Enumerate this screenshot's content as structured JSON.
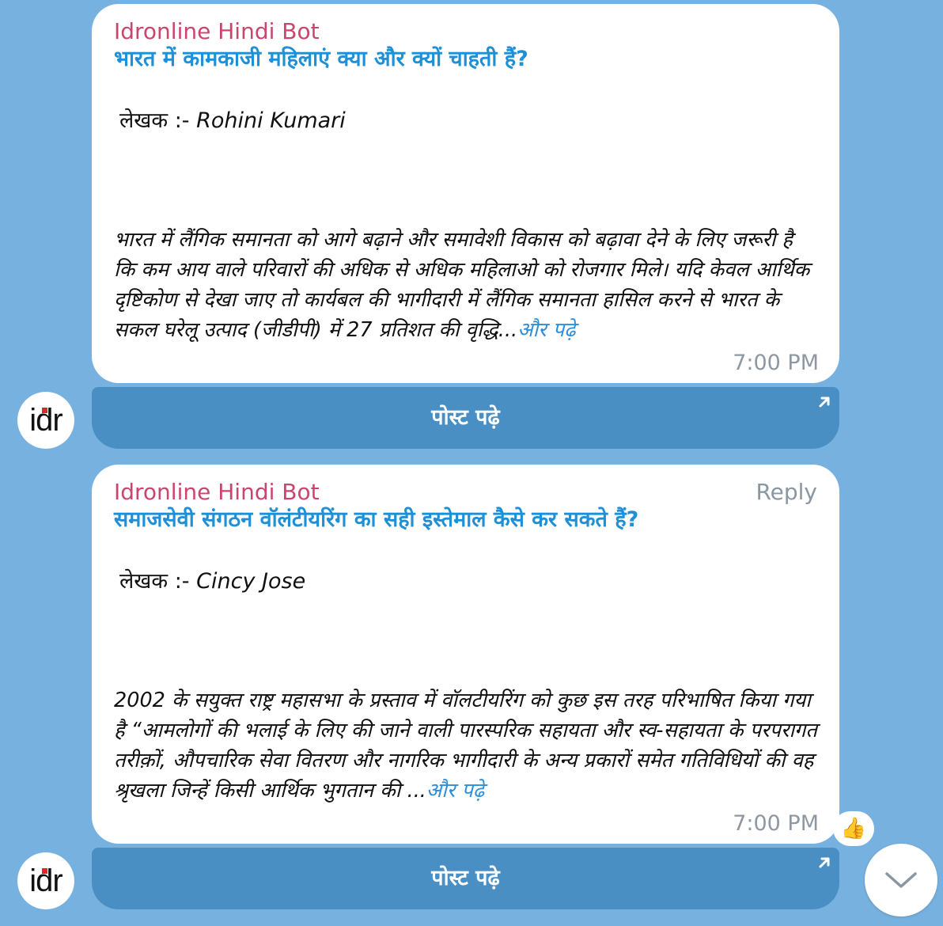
{
  "messages": [
    {
      "sender": "Idronline Hindi Bot",
      "title": "भारत में कामकाजी महिलाएं क्या और क्यों चाहती हैं?",
      "author_label": "लेखक :-",
      "author_name": "Rohini Kumari",
      "excerpt": "भारत में लैंगिक समानता को आगे बढ़ाने और समावेशी विकास को बढ़ावा देने के लिए जरूरी है कि कम आय वाले परिवारों की अधिक से अधिक महिलाओ को रोजगार मिले। यदि केवल आर्थिक दृष्टिकोण से देखा जाए तो कार्यबल की भागीदारी में लैंगिक समानता हासिल करने से भारत के सकल घरेलू उत्पाद (जीडीपी) में 27 प्रतिशत की वृद्धि...",
      "read_more": "और पढ़े",
      "time": "7:00 PM",
      "button_label": "पोस्ट पढ़े"
    },
    {
      "sender": "Idronline Hindi Bot",
      "reply_label": "Reply",
      "title": "समाजसेवी संगठन वॉलंटीयरिंग का सही इस्तेमाल कैसे कर सकते हैं?",
      "author_label": "लेखक :-",
      "author_name": "Cincy Jose",
      "excerpt": "2002 के सयुक्त राष्ट्र महासभा के प्रस्ताव में वॉलटीयरिंग को कुछ इस तरह परिभाषित किया गया है “आमलोगों की भलाई के लिए की जाने वाली पारस्परिक सहायता और स्व-सहायता के परपरागत तरीक़ों, औपचारिक सेवा वितरण और नागरिक भागीदारी के अन्य प्रकारों समेत गतिविधियों की वह श्रृखला जिन्हें किसी आर्थिक भुगतान की ...",
      "read_more": "और पढ़े",
      "time": "7:00 PM",
      "button_label": "पोस्ट पढ़े",
      "reaction": "👍"
    }
  ],
  "avatar": {
    "text": "idr"
  },
  "icons": {
    "external_link": "arrow-up-right-icon",
    "scroll_down": "chevron-down-icon"
  },
  "colors": {
    "background": "#76b1df",
    "bubble": "#ffffff",
    "sender": "#c9476f",
    "title": "#1f8fd6",
    "button": "#4a8fc3",
    "link": "#2e8fd8",
    "time": "#8e98a2"
  }
}
